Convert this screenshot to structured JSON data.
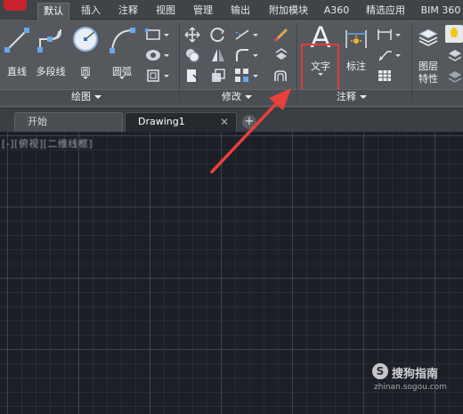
{
  "ribbon_tabs": [
    "默认",
    "插入",
    "注释",
    "视图",
    "管理",
    "输出",
    "附加模块",
    "A360",
    "精选应用",
    "BIM 360"
  ],
  "active_tab": "默认",
  "panels": {
    "draw": {
      "title": "绘图",
      "line_label": "直线",
      "polyline_label": "多段线",
      "circle_label": "圆",
      "arc_label": "圆弧"
    },
    "modify": {
      "title": "修改"
    },
    "annotation": {
      "title": "注释",
      "text_label": "文字",
      "dimension_label": "标注",
      "text_glyph": "A"
    },
    "layers": {
      "label_line1": "图层",
      "label_line2": "特性"
    }
  },
  "document_tabs": [
    {
      "label": "开始",
      "active": false
    },
    {
      "label": "Drawing1",
      "active": true
    }
  ],
  "add_tab_symbol": "+",
  "close_symbol": "✕",
  "viewport_label": "[-][俯视][二维线框]",
  "watermark": {
    "logo": "S",
    "brand": "搜狗指南",
    "url": "zhinan.sogou.com"
  },
  "colors": {
    "ribbon_bg": "#55595e",
    "canvas_bg": "#1c1f25",
    "highlight": "#e53a3a",
    "arrow": "#e8403a"
  }
}
